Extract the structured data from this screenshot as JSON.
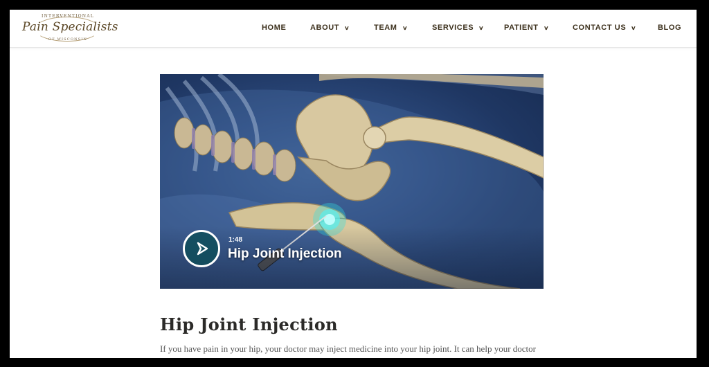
{
  "logo": {
    "top_text": "INTERVENTIONAL",
    "main_text": "Pain Specialists",
    "bottom_text": "OF WISCONSIN"
  },
  "nav": {
    "items": [
      {
        "label": "HOME",
        "has_dropdown": false
      },
      {
        "label": "ABOUT",
        "has_dropdown": true
      },
      {
        "label": "TEAM",
        "has_dropdown": true
      },
      {
        "label": "SERVICES",
        "has_dropdown": true
      },
      {
        "label": "PATIENT",
        "has_dropdown": true
      },
      {
        "label": "CONTACT US",
        "has_dropdown": true
      },
      {
        "label": "BLOG",
        "has_dropdown": false
      }
    ],
    "chevron_icon": "chevron-down-icon"
  },
  "video": {
    "duration": "1:48",
    "title": "Hip Joint Injection",
    "play_icon": "play-icon",
    "accent_color": "#0f4e5a"
  },
  "content": {
    "heading": "Hip Joint Injection",
    "intro": "If you have pain in your hip, your doctor may inject medicine into your hip joint. It can help your doctor"
  }
}
